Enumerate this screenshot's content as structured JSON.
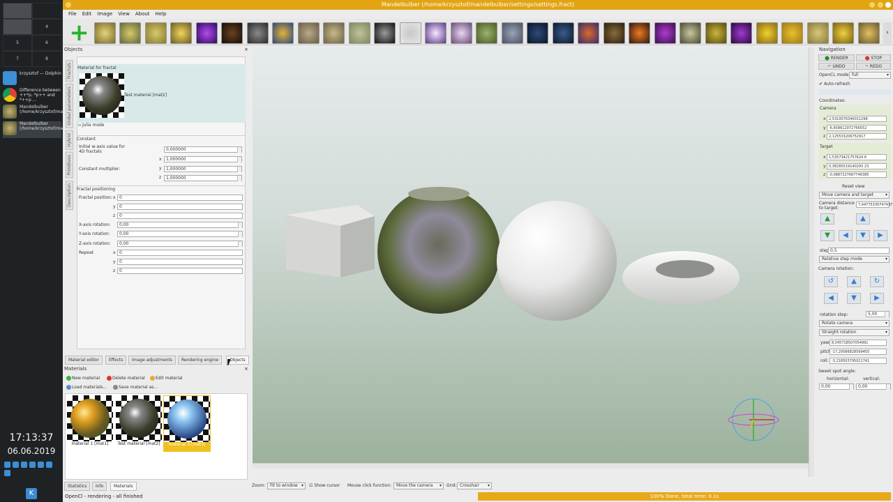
{
  "window": {
    "title": "Mandelbulber (/home/krzysztof/mandelbulber/settings/settings.fract)"
  },
  "menu": [
    "File",
    "Edit",
    "Image",
    "View",
    "About",
    "Help"
  ],
  "taskbar": {
    "pager": [
      "",
      "",
      "",
      "4",
      "5",
      "6",
      "7",
      "8"
    ],
    "tasks": [
      {
        "label": "krzysztof — Dolphin"
      },
      {
        "label": "Difference between ++*p, *p++ and *++p ..."
      },
      {
        "label": "Mandelbulber (/home/krzysztof/mandelbulber/s..."
      },
      {
        "label": "Mandelbulber (/home/krzysztof/mandelbulber/s..."
      }
    ],
    "clock": "17:13:37",
    "date": "06.06.2019"
  },
  "objects_panel": {
    "title": "Objects",
    "vtabs": [
      "Fractals",
      "Global parameters",
      "Hybrid",
      "Primitives",
      "Description"
    ],
    "material_header": "Material for fractal",
    "material_name": "Test material [mat2]",
    "julia_mode": "Julia mode",
    "constant_section": "Constant",
    "initial_w_label": "Initial w-axis value for 4D fractals",
    "initial_w": "0,000000",
    "const_mult_label": "Constant multiplier:",
    "const_x": "1,000000",
    "const_y": "1,000000",
    "const_z": "1,000000",
    "positioning_section": "Fractal positioning",
    "fractal_position_label": "Fractal position:",
    "pos_x": "0",
    "pos_y": "0",
    "pos_z": "0",
    "x_rot_label": "X-axis rotation:",
    "x_rot": "0,00",
    "y_rot_label": "Y-axis rotation:",
    "y_rot": "0,00",
    "z_rot_label": "Z-axis rotation:",
    "z_rot": "0,00",
    "repeat_label": "Repeat",
    "rep_x": "0",
    "rep_y": "0",
    "rep_z": "0"
  },
  "bottom_tabs": [
    "Material editor",
    "Effects",
    "Image adjustments",
    "Rendering engine",
    "Objects"
  ],
  "materials_panel": {
    "title": "Materials",
    "new": "New material",
    "delete": "Delete material",
    "edit": "Edit material",
    "load": "Load materials...",
    "save": "Save material as...",
    "items": [
      {
        "label": "material 1 [mat1]"
      },
      {
        "label": "Test material [mat2]"
      },
      {
        "label": "material 3 [mat3]"
      }
    ],
    "tabs": [
      "Statistics",
      "Info",
      "Materials"
    ]
  },
  "navigation": {
    "title": "Navigation",
    "render": "RENDER",
    "stop": "STOP",
    "undo": "UNDO",
    "redo": "REDO",
    "opencl_label": "OpenCL mode:",
    "opencl_value": "full",
    "auto_refresh": "Auto-refresh",
    "coordinates": "Coordinates:",
    "camera": "Camera",
    "cam_x": "2,5310076340011298",
    "cam_y": "-6,658612972766552",
    "cam_z": "2,125533206752917",
    "target": "Target",
    "tgt_x": "1,53573421757624 6",
    "tgt_y": "0,38285519140293 23",
    "tgt_z": "-0,0887227667746385",
    "reset_view": "Reset view",
    "move_mode": "Move camera and target",
    "cam_dist_label": "Camera distance to target:",
    "cam_dist": "7,44775330747437",
    "step_label": "step:",
    "step": "0,5",
    "step_mode": "Relative step mode",
    "camera_rotation": "Camera rotation:",
    "rotation_step_label": "rotation step:",
    "rotation_step": "5,00",
    "rotate_mode": "Rotate camera",
    "rotation_type": "Straight rotation",
    "yaw": "8,045718507054991",
    "pitch": "-17,29586828599455",
    "roll": "-3,218503795021741",
    "sweet_spot": "Sweet spot angle:",
    "horizontal": "horizontal:",
    "vertical": "vertical:",
    "h_val": "0,00",
    "v_val": "0,00"
  },
  "view_controls": {
    "zoom_label": "Zoom:",
    "zoom_value": "Fit to window",
    "show_cursor": "Show cursor",
    "mouse_label": "Mouse click function:",
    "mouse_value": "Move the camera",
    "grid_label": "Grid:",
    "grid_value": "Crosshair"
  },
  "status": {
    "left": "OpenCl - rendering - all finished",
    "progress_text": "100% Done, total time: 0.1s",
    "progress": 1.0
  },
  "colors": {
    "accent": "#e2a412",
    "taskbar": "#1f2224",
    "viewport_top": "#e6ebec",
    "viewport_bottom": "#9cb29c"
  }
}
